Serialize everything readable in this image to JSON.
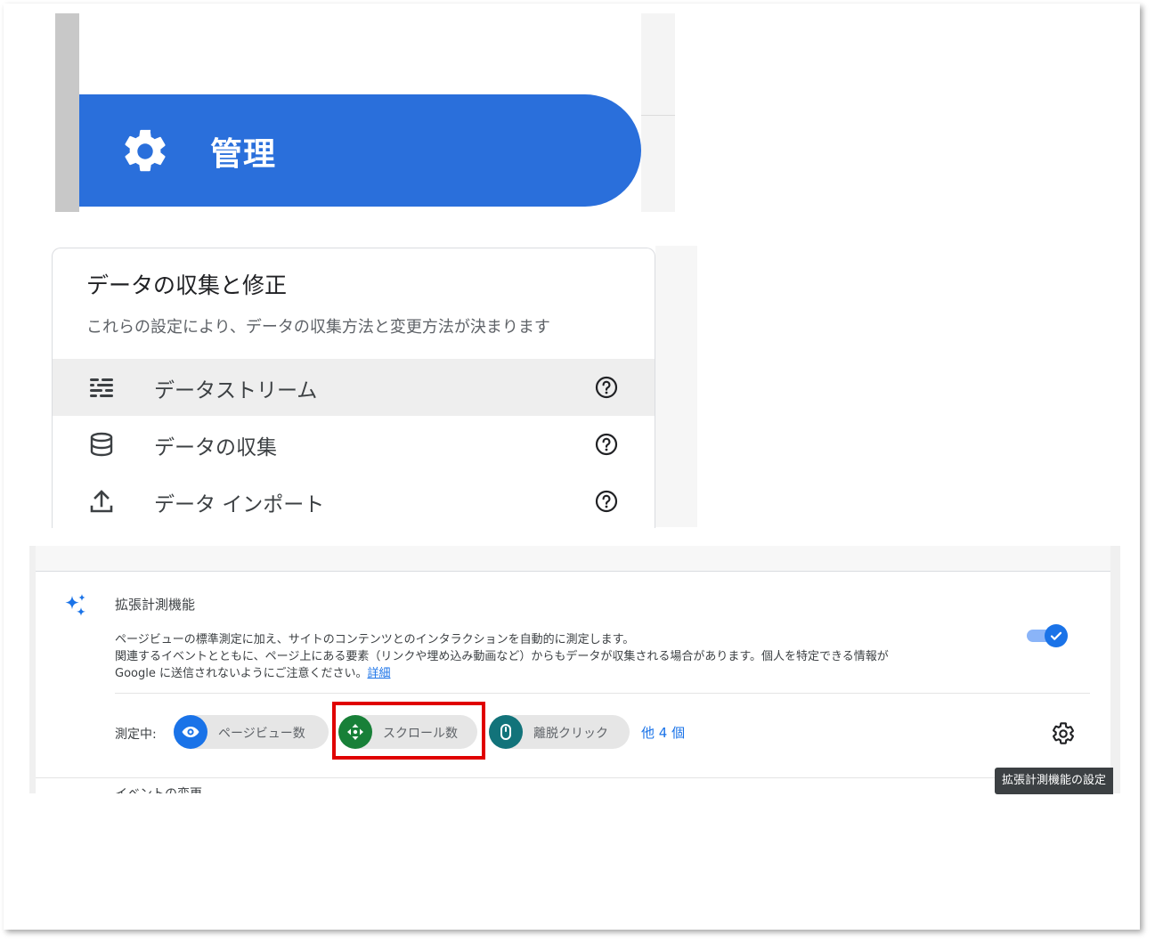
{
  "admin_nav": {
    "label": "管理",
    "icon": "gear-icon",
    "accent": "#2a6fdb"
  },
  "data_collection": {
    "title": "データの収集と修正",
    "subtitle": "これらの設定により、データの収集方法と変更方法が決まります",
    "items": [
      {
        "label": "データストリーム",
        "icon": "data-streams-icon",
        "active": true
      },
      {
        "label": "データの収集",
        "icon": "database-icon",
        "active": false
      },
      {
        "label": "データ インポート",
        "icon": "upload-icon",
        "active": false
      }
    ]
  },
  "enhanced_measurement": {
    "title": "拡張計測機能",
    "description_line1": "ページビューの標準測定に加え、サイトのコンテンツとのインタラクションを自動的に測定します。",
    "description_line2": "関連するイベントとともに、ページ上にある要素（リンクや埋め込み動画など）からもデータが収集される場合があります。個人を特定できる情報が",
    "description_line3": "Google に送信されないようにご注意ください。",
    "learn_more": "詳細",
    "enabled": true,
    "measuring_label": "測定中:",
    "chips": [
      {
        "label": "ページビュー数",
        "icon": "eye-icon",
        "color": "#1a73e8"
      },
      {
        "label": "スクロール数",
        "icon": "scroll-icon",
        "color": "#188038"
      },
      {
        "label": "離脱クリック",
        "icon": "mouse-icon",
        "color": "#12737a"
      }
    ],
    "more": "他 4 個",
    "settings_tooltip": "拡張計測機能の設定",
    "next_section_partial": "イベントの変更"
  },
  "highlight_color": "#e00000"
}
